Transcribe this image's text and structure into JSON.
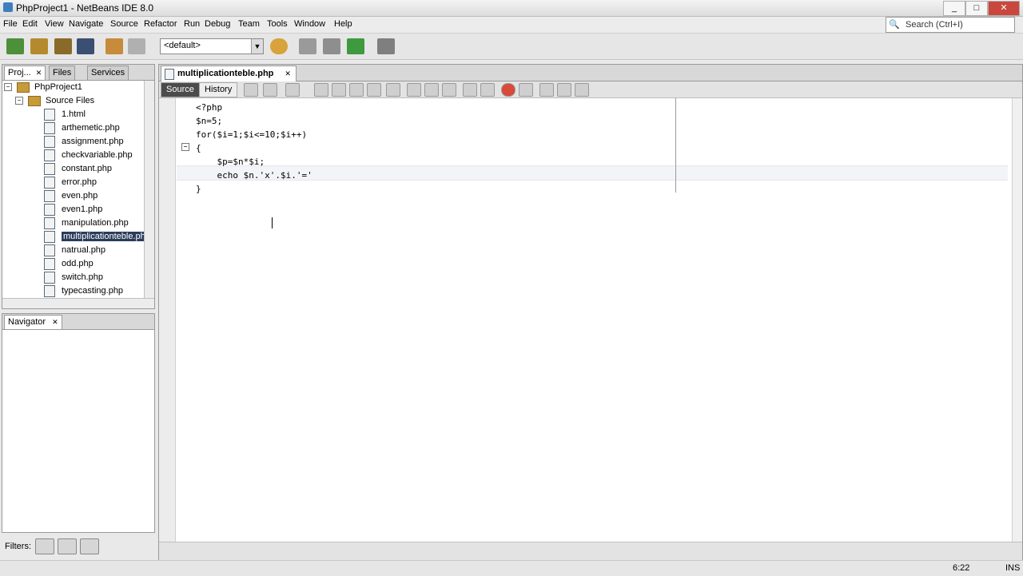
{
  "window": {
    "title": "PhpProject1 - NetBeans IDE 8.0",
    "controls": [
      "_",
      "□",
      "✕"
    ]
  },
  "menu": [
    "File",
    "Edit",
    "View",
    "Navigate",
    "Source",
    "Refactor",
    "Run",
    "Debug",
    "Team",
    "Tools",
    "Window",
    "Help"
  ],
  "search": {
    "placeholder": "Search (Ctrl+I)"
  },
  "toolbar": {
    "config_value": "<default>"
  },
  "projects_panel": {
    "tabs": [
      "Proj...",
      "Files",
      "Services"
    ],
    "project": "PhpProject1",
    "source_files": "Source Files",
    "files": [
      "1.html",
      "arthemetic.php",
      "assignment.php",
      "checkvariable.php",
      "constant.php",
      "error.php",
      "even.php",
      "even1.php",
      "manipulation.php",
      "multiplicationteble.php",
      "natrual.php",
      "odd.php",
      "switch.php",
      "typecasting.php"
    ],
    "selected_index": 9
  },
  "navigator": {
    "title": "Navigator"
  },
  "filters": {
    "label": "Filters:"
  },
  "editor": {
    "tab": "multiplicationteble.php",
    "source_tab": "Source",
    "history_tab": "History",
    "lines": [
      "<?php",
      "$n=5;",
      "for($i=1;$i<=10;$i++)",
      "{",
      "    $p=$n*$i;",
      "    echo $n.'x'.$i.'='",
      "}"
    ]
  },
  "status": {
    "position": "6:22",
    "mode": "INS"
  }
}
